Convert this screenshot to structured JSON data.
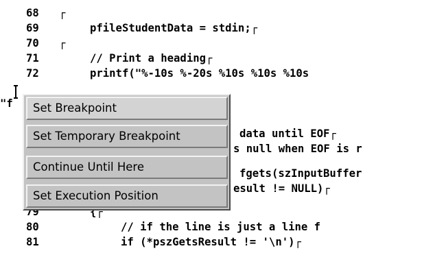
{
  "editor": {
    "lines": [
      {
        "num": "68",
        "text": "┌"
      },
      {
        "num": "69",
        "text": "pfileStudentData = stdin;┌"
      },
      {
        "num": "70",
        "text": "┌"
      },
      {
        "num": "71",
        "text": "// Print a heading┌"
      },
      {
        "num": "72",
        "text": "printf(\"%-10s %-20s %10s %10s %10s"
      },
      {
        "num": "",
        "text": "data until EOF┌"
      },
      {
        "num": "",
        "text": "s null when EOF is r"
      },
      {
        "num": "",
        "text": "fgets(szInputBuffer"
      },
      {
        "num": "",
        "text": "esult != NULL)┌"
      },
      {
        "num": "79",
        "text": "{┌"
      },
      {
        "num": "80",
        "text": "// if the line is just a line f"
      },
      {
        "num": "81",
        "text": "if (*pszGetsResult != '\\n')┌"
      }
    ],
    "left_margin_fragment": "\"f"
  },
  "context_menu": {
    "items": [
      {
        "label": "Set Breakpoint"
      },
      {
        "label": "Set Temporary Breakpoint"
      },
      {
        "label": "Continue Until Here"
      },
      {
        "label": "Set Execution Position"
      }
    ]
  }
}
